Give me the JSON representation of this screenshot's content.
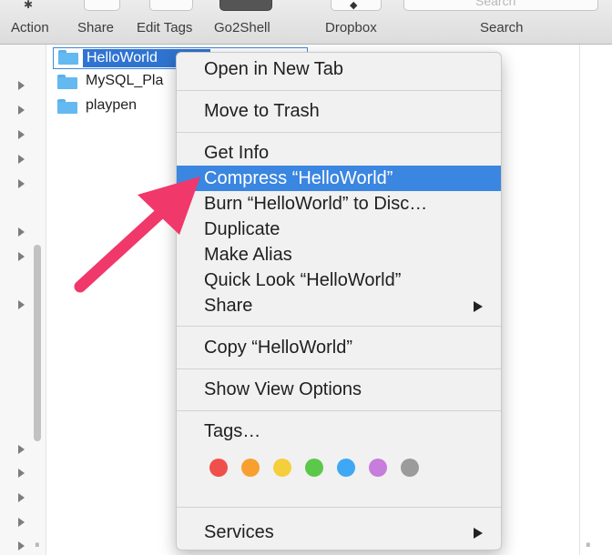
{
  "toolbar": {
    "items": [
      {
        "label": "Action",
        "icon": "gear-icon"
      },
      {
        "label": "Share",
        "icon": "share-icon"
      },
      {
        "label": "Edit Tags",
        "icon": "tag-icon"
      },
      {
        "label": "Go2Shell",
        "icon": "terminal-icon"
      },
      {
        "label": "Dropbox",
        "icon": "dropbox-icon"
      }
    ],
    "search_label": "Search",
    "search_placeholder": "Search"
  },
  "files": [
    {
      "name": "HelloWorld",
      "selected": true
    },
    {
      "name": "MySQL_Pla",
      "selected": false
    },
    {
      "name": "playpen",
      "selected": false
    }
  ],
  "context_menu": {
    "items": [
      {
        "label": "Open in New Tab"
      },
      {
        "label": "Move to Trash"
      },
      {
        "label": "Get Info"
      },
      {
        "label": "Compress “HelloWorld”",
        "highlighted": true
      },
      {
        "label": "Burn “HelloWorld” to Disc…"
      },
      {
        "label": "Duplicate"
      },
      {
        "label": "Make Alias"
      },
      {
        "label": "Quick Look “HelloWorld”"
      },
      {
        "label": "Share",
        "submenu": true
      },
      {
        "label": "Copy “HelloWorld”"
      },
      {
        "label": "Show View Options"
      },
      {
        "label": "Tags…"
      },
      {
        "label": "Services",
        "submenu": true
      }
    ],
    "tag_colors": [
      {
        "name": "Red",
        "color": "#f0504b"
      },
      {
        "name": "Orange",
        "color": "#f7a030"
      },
      {
        "name": "Yellow",
        "color": "#f5cf3b"
      },
      {
        "name": "Green",
        "color": "#5cc84b"
      },
      {
        "name": "Blue",
        "color": "#3fa8f4"
      },
      {
        "name": "Purple",
        "color": "#c77ddb"
      },
      {
        "name": "Gray",
        "color": "#9b9b9b"
      }
    ]
  },
  "colors": {
    "selection": "#3a86e0",
    "annotation_arrow": "#f0386b"
  }
}
